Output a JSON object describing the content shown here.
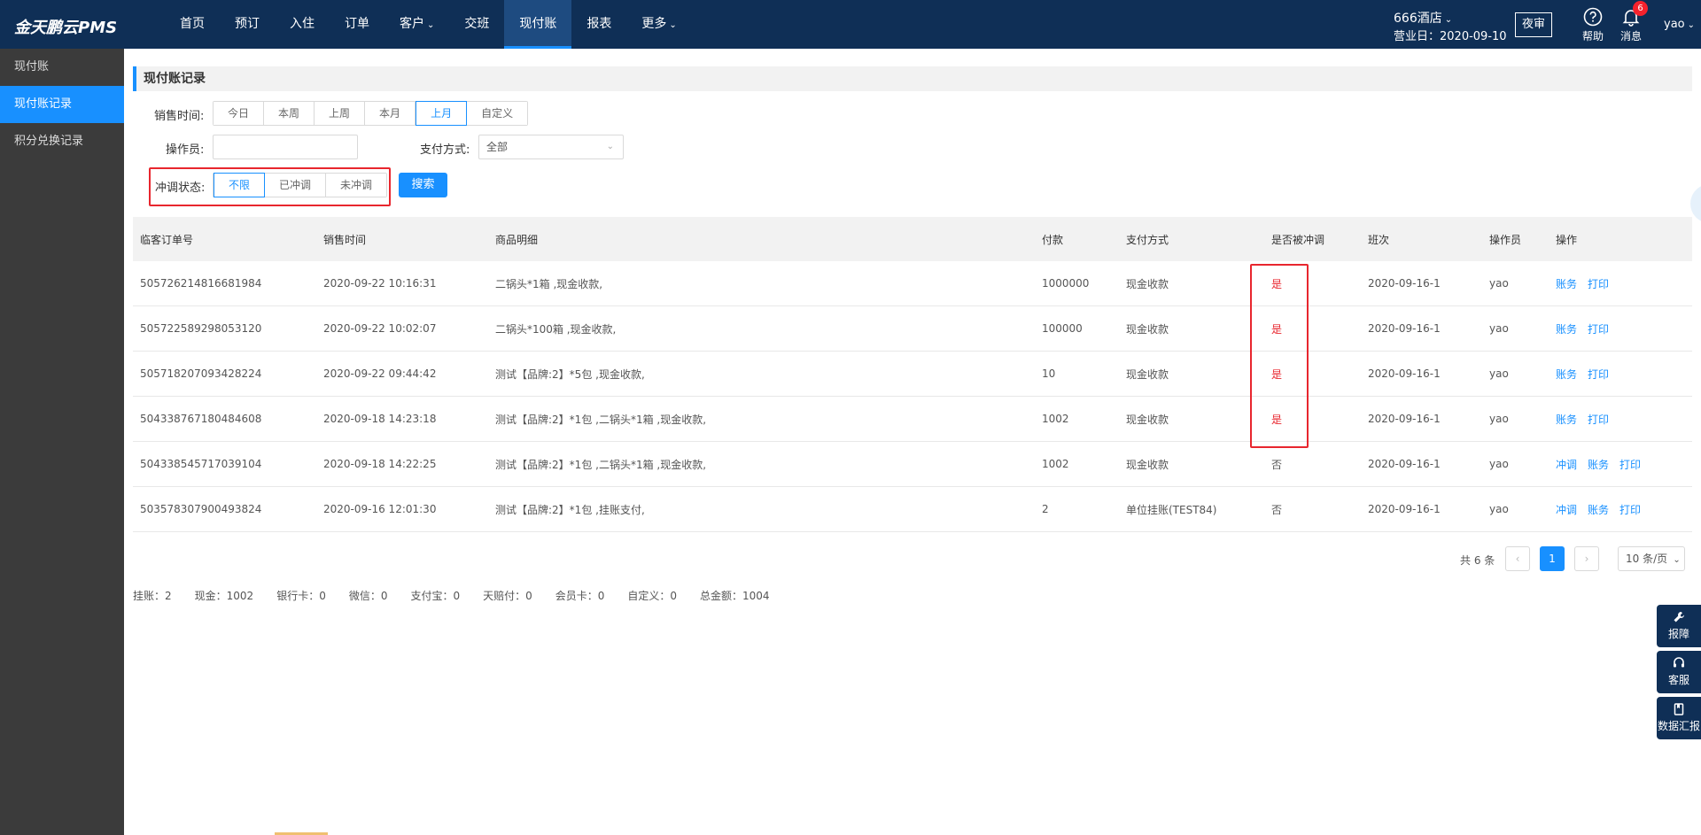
{
  "app": {
    "logo": "金天鹏云PMS"
  },
  "nav": {
    "items": [
      {
        "label": "首页"
      },
      {
        "label": "预订"
      },
      {
        "label": "入住"
      },
      {
        "label": "订单"
      },
      {
        "label": "客户"
      },
      {
        "label": "交班"
      },
      {
        "label": "现付账"
      },
      {
        "label": "报表"
      },
      {
        "label": "更多"
      }
    ],
    "active": "现付账"
  },
  "header": {
    "hotel": "666酒店",
    "business_date": "营业日：2020-09-10",
    "audit_button": "夜审",
    "help_label": "帮助",
    "messages_label": "消息",
    "messages_count": "6",
    "user": "yao"
  },
  "sidebar": {
    "items": [
      {
        "label": "现付账"
      },
      {
        "label": "现付账记录"
      },
      {
        "label": "积分兑换记录"
      }
    ],
    "active": "现付账记录"
  },
  "main": {
    "section_title": "现付账记录",
    "filters": {
      "sale_time_label": "销售时间:",
      "sale_time_options": [
        "今日",
        "本周",
        "上周",
        "本月",
        "上月",
        "自定义"
      ],
      "sale_time_selected": "上月",
      "operator_label": "操作员:",
      "operator_value": "",
      "payment_label": "支付方式:",
      "payment_value": "全部",
      "reversal_label": "冲调状态:",
      "reversal_options": [
        "不限",
        "已冲调",
        "未冲调"
      ],
      "reversal_selected": "不限",
      "search_button": "搜索"
    },
    "table": {
      "headers": [
        "临客订单号",
        "销售时间",
        "商品明细",
        "付款",
        "支付方式",
        "是否被冲调",
        "班次",
        "操作员",
        "操作"
      ],
      "rows": [
        {
          "order": "505726214816681984",
          "time": "2020-09-22 10:16:31",
          "detail": "二锅头*1箱 ,现金收款,",
          "amount": "1000000",
          "payment": "现金收款",
          "reversed": "是",
          "shift": "2020-09-16-1",
          "operator": "yao",
          "actions": [
            "账务",
            "打印"
          ]
        },
        {
          "order": "505722589298053120",
          "time": "2020-09-22 10:02:07",
          "detail": "二锅头*100箱 ,现金收款,",
          "amount": "100000",
          "payment": "现金收款",
          "reversed": "是",
          "shift": "2020-09-16-1",
          "operator": "yao",
          "actions": [
            "账务",
            "打印"
          ]
        },
        {
          "order": "505718207093428224",
          "time": "2020-09-22 09:44:42",
          "detail": "测试【品牌:2】*5包 ,现金收款,",
          "amount": "10",
          "payment": "现金收款",
          "reversed": "是",
          "shift": "2020-09-16-1",
          "operator": "yao",
          "actions": [
            "账务",
            "打印"
          ]
        },
        {
          "order": "504338767180484608",
          "time": "2020-09-18 14:23:18",
          "detail": "测试【品牌:2】*1包 ,二锅头*1箱 ,现金收款,",
          "amount": "1002",
          "payment": "现金收款",
          "reversed": "是",
          "shift": "2020-09-16-1",
          "operator": "yao",
          "actions": [
            "账务",
            "打印"
          ]
        },
        {
          "order": "504338545717039104",
          "time": "2020-09-18 14:22:25",
          "detail": "测试【品牌:2】*1包 ,二锅头*1箱 ,现金收款,",
          "amount": "1002",
          "payment": "现金收款",
          "reversed": "否",
          "shift": "2020-09-16-1",
          "operator": "yao",
          "actions": [
            "冲调",
            "账务",
            "打印"
          ]
        },
        {
          "order": "503578307900493824",
          "time": "2020-09-16 12:01:30",
          "detail": "测试【品牌:2】*1包 ,挂账支付,",
          "amount": "2",
          "payment": "单位挂账(TEST84)",
          "reversed": "否",
          "shift": "2020-09-16-1",
          "operator": "yao",
          "actions": [
            "冲调",
            "账务",
            "打印"
          ]
        }
      ]
    },
    "pagination": {
      "total": "共 6 条",
      "prev": "‹",
      "current": "1",
      "next": "›",
      "page_size": "10 条/页"
    },
    "summary": [
      "挂账：2",
      "现金：1002",
      "银行卡：0",
      "微信：0",
      "支付宝：0",
      "天赔付：0",
      "会员卡：0",
      "自定义：0",
      "总金额：1004"
    ]
  },
  "float_buttons": [
    {
      "label": "报障",
      "icon": "wrench-icon"
    },
    {
      "label": "客服",
      "icon": "headset-icon"
    },
    {
      "label": "数据汇报",
      "icon": "report-icon"
    }
  ],
  "colors": {
    "nav_bg": "#0f2f56",
    "accent": "#1890ff",
    "highlight_red": "#e8262e",
    "sidebar_bg": "#3b3b3b"
  }
}
